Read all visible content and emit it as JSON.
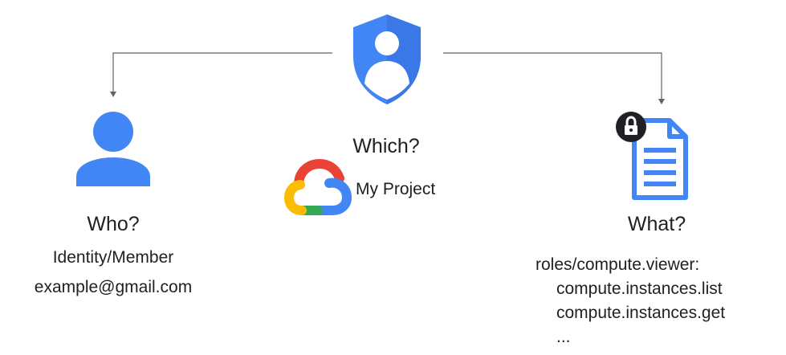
{
  "iam": {
    "shield_icon": "shield-person-icon",
    "which": {
      "question": "Which?",
      "project_icon": "google-cloud-icon",
      "project_name": "My Project"
    },
    "who": {
      "icon": "person-icon",
      "question": "Who?",
      "subtitle": "Identity/Member",
      "example": "example@gmail.com"
    },
    "what": {
      "icon": "locked-document-icon",
      "question": "What?",
      "role": "roles/compute.viewer:",
      "permissions": [
        "compute.instances.list",
        "compute.instances.get",
        "..."
      ]
    },
    "colors": {
      "blue": "#4285F4",
      "blue_dark": "#3B78E7",
      "red": "#EA4335",
      "yellow": "#FBBC04",
      "green": "#34A853",
      "connector": "#5f6368"
    }
  }
}
